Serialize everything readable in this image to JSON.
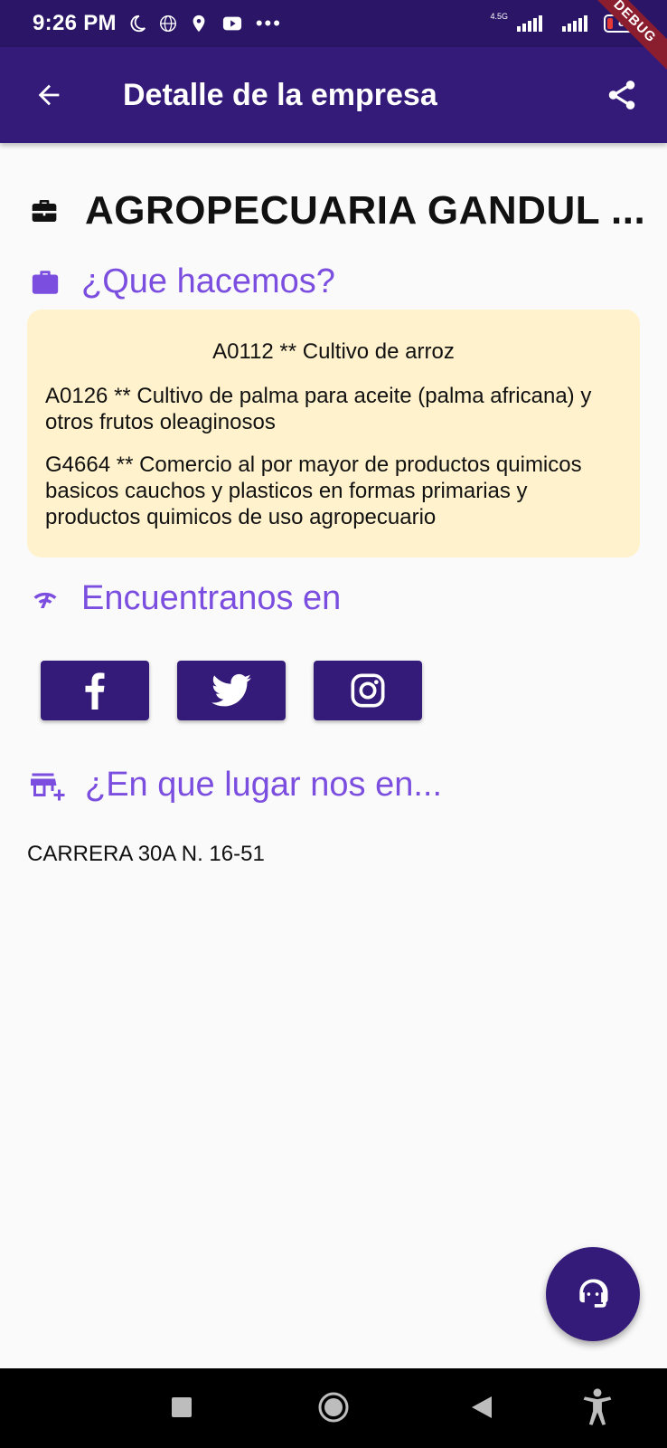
{
  "status_bar": {
    "time": "9:26 PM",
    "network_label": "4.5G",
    "battery_level": "8",
    "debug_banner": "DEBUG"
  },
  "app_bar": {
    "title": "Detalle de la empresa"
  },
  "company": {
    "name": "AGROPECUARIA GANDUL ..."
  },
  "what_we_do": {
    "heading": "¿Que hacemos?",
    "activities": [
      "A0112 ** Cultivo de arroz",
      "A0126 ** Cultivo de palma para aceite (palma africana) y otros frutos oleaginosos",
      "G4664 ** Comercio al por mayor de productos quimicos basicos  cauchos y plasticos en formas primarias y productos quimicos de uso agropecuario"
    ]
  },
  "find_us": {
    "heading": "Encuentranos en",
    "social": [
      "facebook-icon",
      "twitter-icon",
      "instagram-icon"
    ]
  },
  "location": {
    "heading": "¿En que lugar nos en...",
    "address": "CARRERA 30A N. 16-51"
  },
  "colors": {
    "primary": "#341b7a",
    "accent": "#7b4ee0",
    "card_background": "#fff2cc"
  }
}
